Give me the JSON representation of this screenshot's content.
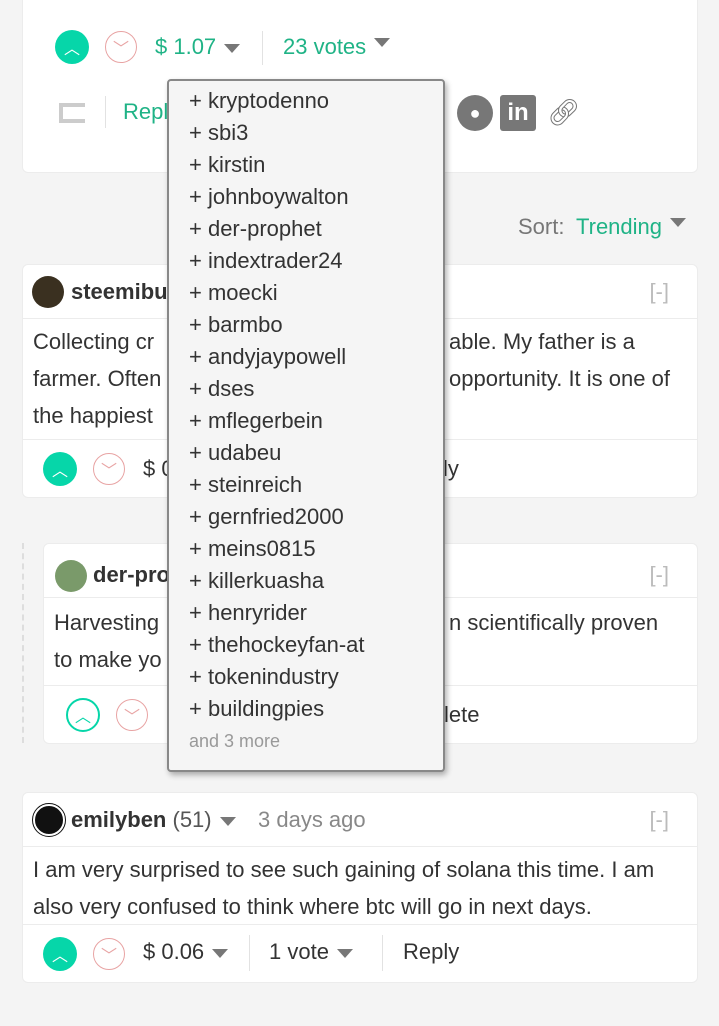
{
  "post": {
    "payout": "$ 1.07",
    "votes": "23 votes",
    "reply": "Reply"
  },
  "sort": {
    "label": "Sort:",
    "value": "Trending"
  },
  "comments": [
    {
      "author": "steemibu",
      "body_l1": "Collecting cr",
      "body_l1b": "able. My father is a",
      "body_l2": "farmer. Often",
      "body_l2b": "opportunity. It is one of",
      "body_l3": "the happiest",
      "payout": "$ 0",
      "reply": "ly",
      "collapse": "[-]"
    },
    {
      "author": "der-pro",
      "body_l1": "Harvesting",
      "body_l1b": "n scientifically proven",
      "body_l2": "to make yo",
      "action": "lete",
      "collapse": "[-]"
    },
    {
      "author": "emilyben",
      "rep": "(51)",
      "time": "3 days ago",
      "body": "I am very surprised to see such gaining of solana this time. I am also very confused to think where btc will go in next days.",
      "payout": "$ 0.06",
      "votes": "1 vote",
      "reply": "Reply",
      "collapse": "[-]"
    }
  ],
  "voters": [
    "+ kryptodenno",
    "+ sbi3",
    "+ kirstin",
    "+ johnboywalton",
    "+ der-prophet",
    "+ indextrader24",
    "+ moecki",
    "+ barmbo",
    "+ andyjaypowell",
    "+ dses",
    "+ mflegerbein",
    "+ udabeu",
    "+ steinreich",
    "+ gernfried2000",
    "+ meins0815",
    "+ killerkuasha",
    "+ henryrider",
    "+ thehockeyfan-at",
    "+ tokenindustry",
    "+ buildingpies"
  ],
  "voters_more": "and 3 more",
  "colors": {
    "accent": "#06d6a9",
    "link": "#1fb386",
    "downvote": "#e8a3a3"
  }
}
